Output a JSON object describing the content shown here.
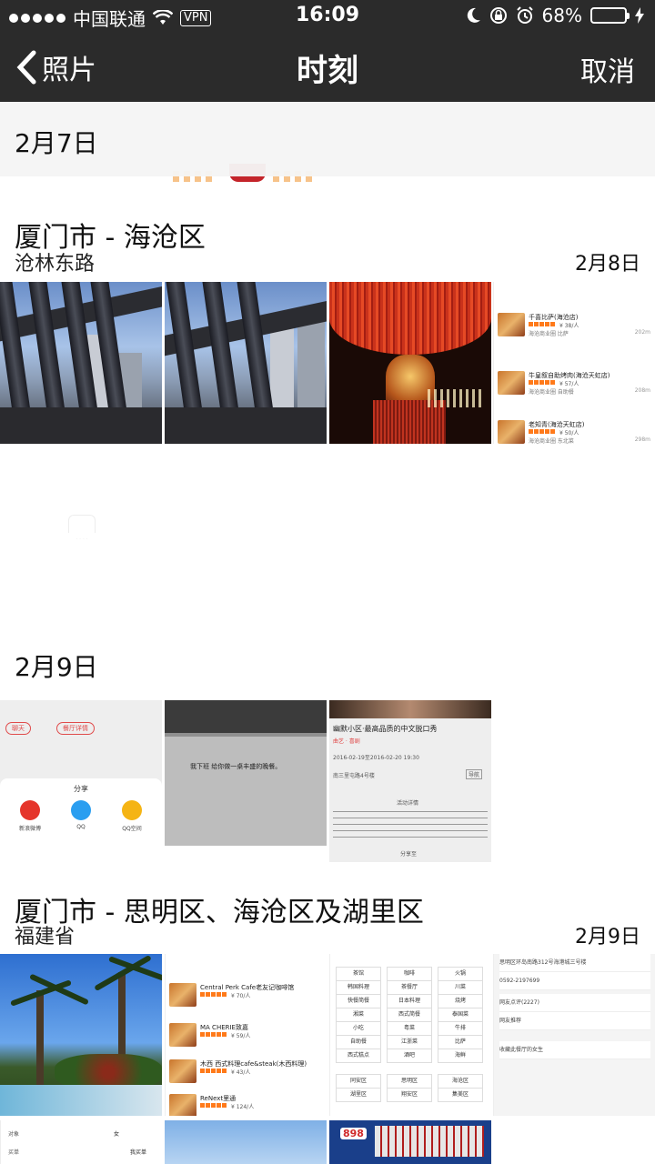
{
  "status_bar": {
    "carrier": "中国联通",
    "vpn": "VPN",
    "time": "16:09",
    "battery": "68%",
    "battery_level": 0.68
  },
  "nav": {
    "back_label": "照片",
    "title": "时刻",
    "cancel_label": "取消"
  },
  "sections": [
    {
      "date": "2月7日"
    },
    {
      "location": "厦门市 - 海沧区",
      "sublocation": "沧林东路",
      "date": "2月8日"
    },
    {
      "date": "2月9日"
    },
    {
      "location": "厦门市 - 思明区、海沧区及湖里区",
      "sublocation": "福建省",
      "date": "2月9日"
    }
  ],
  "screenshot1": {
    "items": [
      {
        "name": "千喜比萨(海沧店)",
        "price": "¥ 38/人",
        "meta": "海沧商业圈 比萨",
        "dist": "202m"
      },
      {
        "name": "牛皇叙自助烤肉(海沧天虹店)",
        "price": "¥ 57/人",
        "meta": "海沧商业圈 自助餐",
        "dist": "208m"
      },
      {
        "name": "老知青(海沧天虹店)",
        "price": "¥ 50/人",
        "meta": "海沧商业圈 东北菜",
        "dist": "298m"
      }
    ]
  },
  "screenshot_share": {
    "title": "分享",
    "targets": [
      "新浪微博",
      "QQ",
      "QQ空间"
    ],
    "chat": "聊天",
    "detail": "餐厅详情",
    "post": "我下班 给你做一桌丰盛的晚餐。"
  },
  "screenshot_event": {
    "title": "幽默小区·最高品质的中文脱口秀",
    "tag": "曲艺 · 喜剧",
    "date": "2016-02-19至2016-02-20 19:30",
    "address": "南三里屯路4号楼",
    "nav_btn": "导航",
    "section": "活动详情",
    "share": "分享至"
  },
  "screenshot_food": {
    "items": [
      {
        "name": "Central Perk Cafe老友记咖啡馆",
        "price": "¥ 70/人"
      },
      {
        "name": "MA CHERIE致嘉",
        "price": "¥ 59/人"
      },
      {
        "name": "木西 西式料理cafe&steak(木西料理)",
        "price": "¥ 43/人"
      },
      {
        "name": "ReNext里通",
        "price": "¥ 124/人"
      }
    ]
  },
  "screenshot_categories": {
    "cats": [
      "茶馆",
      "咖啡",
      "火锅",
      "韩国料理",
      "茶餐厅",
      "川菜",
      "快餐简餐",
      "日本料理",
      "烧烤",
      "湘菜",
      "西式简餐",
      "泰国菜",
      "小吃",
      "粤菜",
      "牛排",
      "自助餐",
      "江浙菜",
      "比萨",
      "西式糕点",
      "酒吧",
      "海鲜"
    ],
    "areas": [
      "同安区",
      "思明区",
      "海沧区",
      "湖里区",
      "翔安区",
      "集美区"
    ]
  },
  "screenshot_detail": {
    "address": "思明区环岛南路312号海港城三号楼",
    "phone": "0592-2197699",
    "reviews": "网友点评(2227)",
    "recommend": "网友推荐",
    "fav": "收藏此餐厅的女生"
  },
  "bottom_row": {
    "label1": "对象",
    "label2": "女",
    "label3": "买单",
    "label4": "我买单",
    "badge": "898"
  },
  "colors": {
    "bar_bg": "#2b2b2b",
    "battery_green": "#4cd964",
    "accent_orange": "#ff7a1a"
  },
  "icons": [
    "signal-dots-icon",
    "wifi-icon",
    "moon-icon",
    "rotation-lock-icon",
    "alarm-icon",
    "charging-icon",
    "chevron-left-icon"
  ]
}
